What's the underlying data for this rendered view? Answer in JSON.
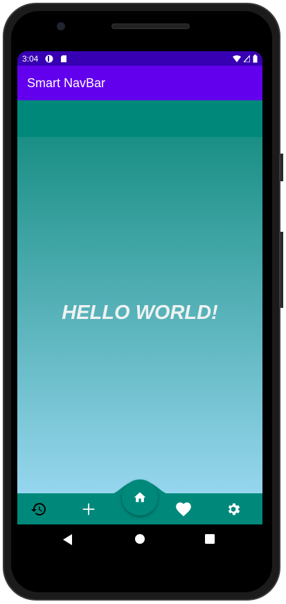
{
  "status_bar": {
    "time": "3:04"
  },
  "app_bar": {
    "title": "Smart NavBar"
  },
  "content": {
    "text": "HELLO WORLD!"
  },
  "colors": {
    "status": "#3700b3",
    "primary": "#6200ee",
    "teal": "#00897b"
  },
  "nav": {
    "items": [
      {
        "icon": "history-icon"
      },
      {
        "icon": "add-icon"
      },
      {
        "icon": "home-icon",
        "selected": true
      },
      {
        "icon": "heart-icon"
      },
      {
        "icon": "settings-icon"
      }
    ]
  }
}
